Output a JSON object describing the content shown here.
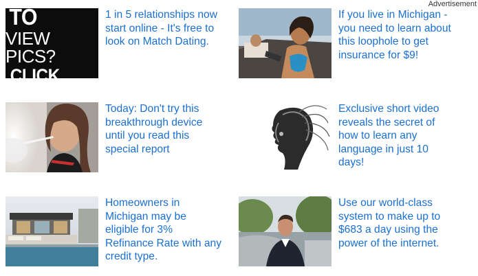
{
  "header": {
    "label": "Advertisement"
  },
  "ads": [
    {
      "thumb_lines": [
        "WANT TO",
        "VIEW PICS?",
        "CLICK HERE"
      ],
      "icon": "dating-banner-image",
      "text": "1 in 5 relationships now start online - It's free to look on Match Dating."
    },
    {
      "icon": "woman-driving-car-image",
      "text": "If you live in Michigan - you need to learn about this loophole to get insurance for $9!"
    },
    {
      "icon": "woman-smoking-ecig-image",
      "text": "Today: Don't try this breakthrough device until you read this special report"
    },
    {
      "icon": "robot-head-image",
      "text": "Exclusive short video reveals the secret of how to learn any language in just 10 days!"
    },
    {
      "icon": "modern-house-image",
      "text": "Homeowners in Michigan may be eligible for 3% Refinance Rate with any credit type."
    },
    {
      "icon": "man-in-suit-image",
      "text": "Use our world-class system to make up to $683 a day using the power of the internet."
    }
  ],
  "colors": {
    "link": "#1a6fd1",
    "label": "#333333"
  }
}
